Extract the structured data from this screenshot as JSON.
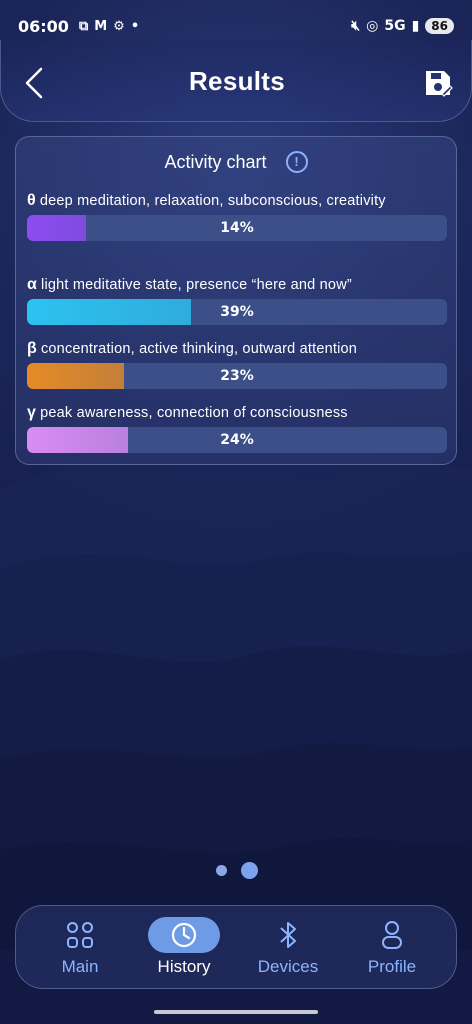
{
  "status_bar": {
    "time": "06:00",
    "network": "5G",
    "battery": "86"
  },
  "header": {
    "title": "Results"
  },
  "chart": {
    "title": "Activity chart",
    "info_symbol": "!",
    "waves": [
      {
        "symbol": "θ",
        "label": "deep meditation, relaxation, subconscious, creativity",
        "percent_label": "14%",
        "color": "#8e4cf2"
      },
      {
        "symbol": "α",
        "label": "light meditative state, presence “here and now”",
        "percent_label": "39%",
        "color": "#2cc3f0"
      },
      {
        "symbol": "β",
        "label": "concentration, active thinking, outward attention",
        "percent_label": "23%",
        "color": "#e58b27"
      },
      {
        "symbol": "γ",
        "label": "peak awareness, connection of consciousness",
        "percent_label": "24%",
        "color": "#d98cf4"
      }
    ]
  },
  "chart_data": {
    "type": "bar",
    "title": "Activity chart",
    "categories": [
      "θ",
      "α",
      "β",
      "γ"
    ],
    "values": [
      14,
      39,
      23,
      24
    ],
    "ylim": [
      0,
      100
    ]
  },
  "pager": {
    "count": 2,
    "active": 2
  },
  "nav": {
    "items": [
      {
        "label": "Main",
        "icon": "grid-icon"
      },
      {
        "label": "History",
        "icon": "clock-icon"
      },
      {
        "label": "Devices",
        "icon": "bluetooth-icon"
      },
      {
        "label": "Profile",
        "icon": "person-icon"
      }
    ],
    "active": 1
  }
}
